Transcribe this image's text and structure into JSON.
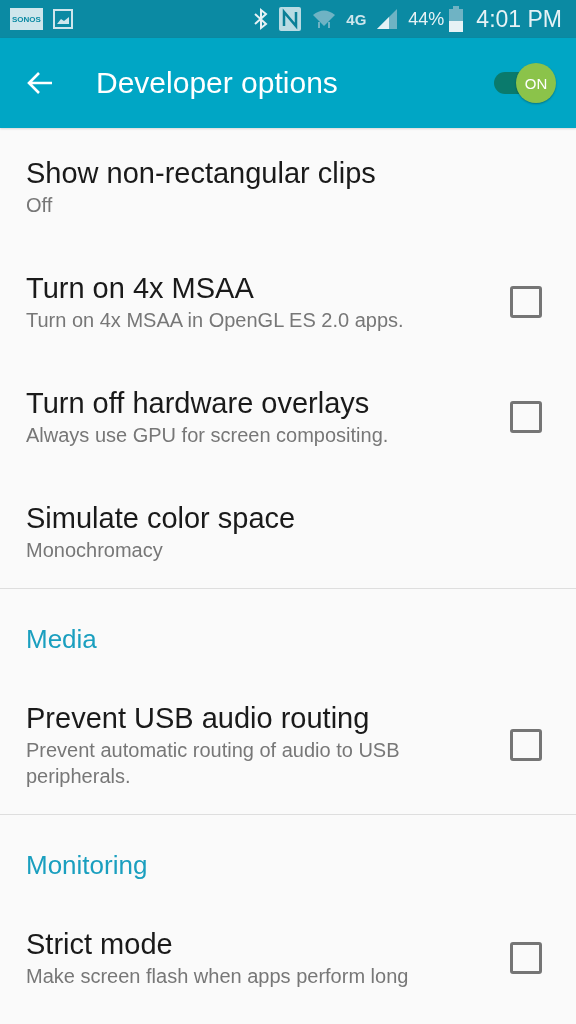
{
  "status_bar": {
    "notification_label": "SONOS",
    "network_type": "4G",
    "battery": "44%",
    "time": "4:01 PM"
  },
  "app_bar": {
    "title": "Developer options",
    "switch": {
      "label": "ON",
      "on": true
    }
  },
  "sections": [
    {
      "items": [
        {
          "kind": "value",
          "title": "Show non-rectangular clips",
          "summary": "Off"
        },
        {
          "kind": "checkbox",
          "title": "Turn on 4x MSAA",
          "summary": "Turn on 4x MSAA in OpenGL ES 2.0 apps.",
          "checked": false
        },
        {
          "kind": "checkbox",
          "title": "Turn off hardware overlays",
          "summary": "Always use GPU for screen compositing.",
          "checked": false
        },
        {
          "kind": "value",
          "title": "Simulate color space",
          "summary": "Monochromacy"
        }
      ]
    },
    {
      "header": "Media",
      "items": [
        {
          "kind": "checkbox",
          "title": "Prevent USB audio routing",
          "summary": "Prevent automatic routing of audio to USB peripherals.",
          "checked": false
        }
      ]
    },
    {
      "header": "Monitoring",
      "items": [
        {
          "kind": "checkbox",
          "title": "Strict mode",
          "summary": "Make screen flash when apps perform long",
          "checked": false
        }
      ]
    }
  ]
}
